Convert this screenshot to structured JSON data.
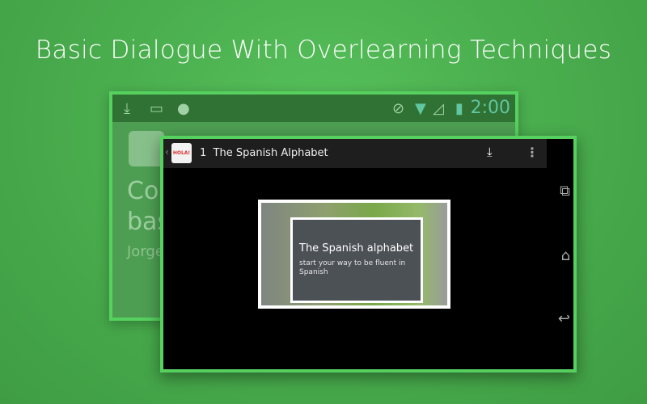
{
  "headline": "Basic Dialogue With Overlearning Techniques",
  "back_screen": {
    "clock": "2:00",
    "title_line1": "Cor",
    "title_line2": "bas",
    "author": "Jorge"
  },
  "front_screen": {
    "lesson_number": "1",
    "lesson_title": "The Spanish Alphabet",
    "logo_text": "HOLA!",
    "slide_title": "The Spanish alphabet",
    "slide_subtitle": "start your way to be fluent in Spanish"
  },
  "colors": {
    "background": "#4aae4e",
    "frame_border": "#56d05f",
    "status_bar": "#2f7233"
  }
}
